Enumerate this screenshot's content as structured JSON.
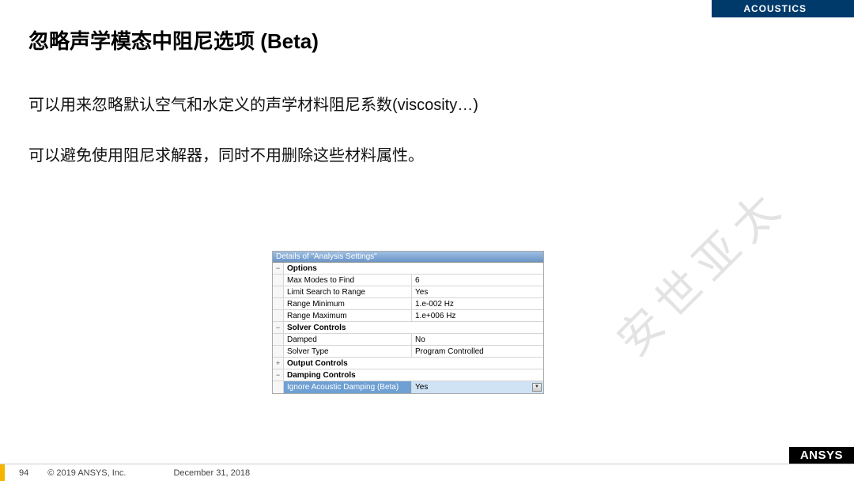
{
  "header": {
    "category": "ACOUSTICS"
  },
  "title": "忽略声学模态中阻尼选项 (Beta)",
  "paragraphs": {
    "p1": "可以用来忽略默认空气和水定义的声学材料阻尼系数(viscosity…)",
    "p2": "可以避免使用阻尼求解器，同时不用删除这些材料属性。"
  },
  "panel": {
    "title": "Details of \"Analysis Settings\"",
    "sections": {
      "options": {
        "indicator": "−",
        "label": "Options"
      },
      "solver_controls": {
        "indicator": "−",
        "label": "Solver Controls"
      },
      "output_controls": {
        "indicator": "+",
        "label": "Output Controls"
      },
      "damping_controls": {
        "indicator": "−",
        "label": "Damping Controls"
      }
    },
    "rows": {
      "max_modes": {
        "label": "Max Modes to Find",
        "value": "6"
      },
      "limit_search": {
        "label": "Limit Search to Range",
        "value": "Yes"
      },
      "range_min": {
        "label": "Range Minimum",
        "value": "1.e-002 Hz"
      },
      "range_max": {
        "label": "Range Maximum",
        "value": "1.e+006 Hz"
      },
      "damped": {
        "label": "Damped",
        "value": "No"
      },
      "solver_type": {
        "label": "Solver Type",
        "value": "Program Controlled"
      },
      "ignore_damping": {
        "label": "Ignore Acoustic Damping (Beta)",
        "value": "Yes"
      }
    }
  },
  "watermark": "安世亚太",
  "footer": {
    "page": "94",
    "copyright": "© 2019 ANSYS, Inc.",
    "date": "December  31, 2018",
    "logo": "ANSYS"
  }
}
